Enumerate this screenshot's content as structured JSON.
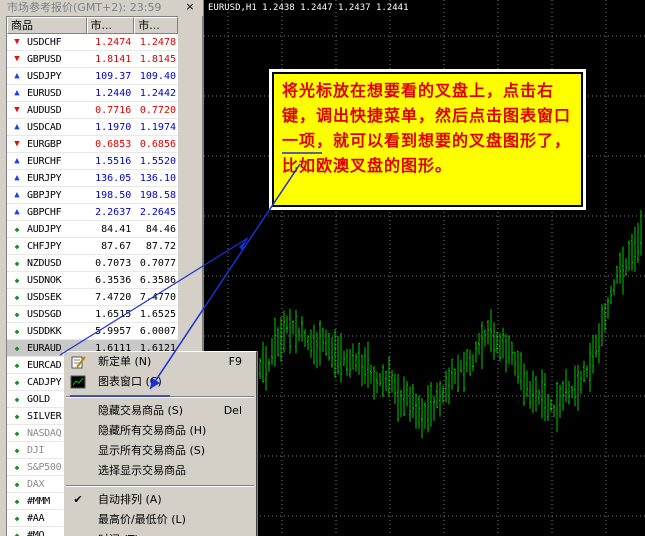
{
  "market_watch": {
    "title": "市场参考报价(GMT+2): 23:59",
    "close_glyph": "×",
    "columns": {
      "symbol": "商品",
      "bid": "市...",
      "ask": "市..."
    },
    "rows": [
      {
        "symbol": "USDCHF",
        "bid": "1.2474",
        "ask": "1.2478",
        "dir": "down"
      },
      {
        "symbol": "GBPUSD",
        "bid": "1.8141",
        "ask": "1.8145",
        "dir": "down"
      },
      {
        "symbol": "USDJPY",
        "bid": "109.37",
        "ask": "109.40",
        "dir": "up"
      },
      {
        "symbol": "EURUSD",
        "bid": "1.2440",
        "ask": "1.2442",
        "dir": "up"
      },
      {
        "symbol": "AUDUSD",
        "bid": "0.7716",
        "ask": "0.7720",
        "dir": "down"
      },
      {
        "symbol": "USDCAD",
        "bid": "1.1970",
        "ask": "1.1974",
        "dir": "up"
      },
      {
        "symbol": "EURGBP",
        "bid": "0.6853",
        "ask": "0.6856",
        "dir": "down"
      },
      {
        "symbol": "EURCHF",
        "bid": "1.5516",
        "ask": "1.5520",
        "dir": "up"
      },
      {
        "symbol": "EURJPY",
        "bid": "136.05",
        "ask": "136.10",
        "dir": "up"
      },
      {
        "symbol": "GBPJPY",
        "bid": "198.50",
        "ask": "198.58",
        "dir": "up"
      },
      {
        "symbol": "GBPCHF",
        "bid": "2.2637",
        "ask": "2.2645",
        "dir": "up"
      },
      {
        "symbol": "AUDJPY",
        "bid": "84.41",
        "ask": "84.46",
        "dir": "none"
      },
      {
        "symbol": "CHFJPY",
        "bid": "87.67",
        "ask": "87.72",
        "dir": "none"
      },
      {
        "symbol": "NZDUSD",
        "bid": "0.7073",
        "ask": "0.7077",
        "dir": "none"
      },
      {
        "symbol": "USDNOK",
        "bid": "6.3536",
        "ask": "6.3586",
        "dir": "none"
      },
      {
        "symbol": "USDSEK",
        "bid": "7.4720",
        "ask": "7.4770",
        "dir": "none"
      },
      {
        "symbol": "USDSGD",
        "bid": "1.6515",
        "ask": "1.6525",
        "dir": "none"
      },
      {
        "symbol": "USDDKK",
        "bid": "5.9957",
        "ask": "6.0007",
        "dir": "none"
      },
      {
        "symbol": "EURAUD",
        "bid": "1.6111",
        "ask": "1.6121",
        "dir": "none",
        "selected": true
      },
      {
        "symbol": "EURCAD",
        "bid": "",
        "ask": "",
        "dir": "none"
      },
      {
        "symbol": "CADJPY",
        "bid": "",
        "ask": "",
        "dir": "none"
      },
      {
        "symbol": "GOLD",
        "bid": "",
        "ask": "",
        "dir": "none"
      },
      {
        "symbol": "SILVER",
        "bid": "",
        "ask": "",
        "dir": "none"
      },
      {
        "symbol": "NASDAQ",
        "bid": "",
        "ask": "",
        "dir": "none",
        "grey": true
      },
      {
        "symbol": "DJI",
        "bid": "",
        "ask": "",
        "dir": "none",
        "grey": true
      },
      {
        "symbol": "S&P500",
        "bid": "",
        "ask": "",
        "dir": "none",
        "grey": true
      },
      {
        "symbol": "DAX",
        "bid": "",
        "ask": "",
        "dir": "none",
        "grey": true
      },
      {
        "symbol": "#MMM",
        "bid": "",
        "ask": "",
        "dir": "none"
      },
      {
        "symbol": "#AA",
        "bid": "",
        "ask": "",
        "dir": "none"
      },
      {
        "symbol": "#MO",
        "bid": "",
        "ask": "",
        "dir": "none"
      }
    ]
  },
  "chart": {
    "header": "EURUSD,H1  1.2438 1.2447 1.2437 1.2441",
    "background": "#000000",
    "bar_color": "#00c800",
    "grid_color": "#7a7a7a"
  },
  "callout": {
    "text": "将光标放在想要看的叉盘上，点击右键，调出快捷菜单，然后点击图表窗口一项，就可以看到想要的叉盘图形了，比如欧澳叉盘的图形。",
    "text_color": "#e00000",
    "background": "#ffff00"
  },
  "context_menu": {
    "items": [
      {
        "label": "新定单 (N)",
        "accel": "F9",
        "icon": "new-order-icon"
      },
      {
        "label": "图表窗口 (C)",
        "accel": "",
        "icon": "chart-window-icon"
      },
      {
        "separator": true
      },
      {
        "label": "隐藏交易商品 (S)",
        "accel": "Del"
      },
      {
        "label": "隐藏所有交易商品 (H)",
        "accel": ""
      },
      {
        "label": "显示所有交易商品 (S)",
        "accel": ""
      },
      {
        "label": "选择显示交易商品",
        "accel": ""
      },
      {
        "separator": true
      },
      {
        "label": "自动排列 (A)",
        "accel": "",
        "checked": true
      },
      {
        "label": "最高价/最低价 (L)",
        "accel": ""
      },
      {
        "label": "时间 (T)",
        "accel": ""
      }
    ]
  },
  "annotation": {
    "line_color": "#1a2fd6"
  }
}
